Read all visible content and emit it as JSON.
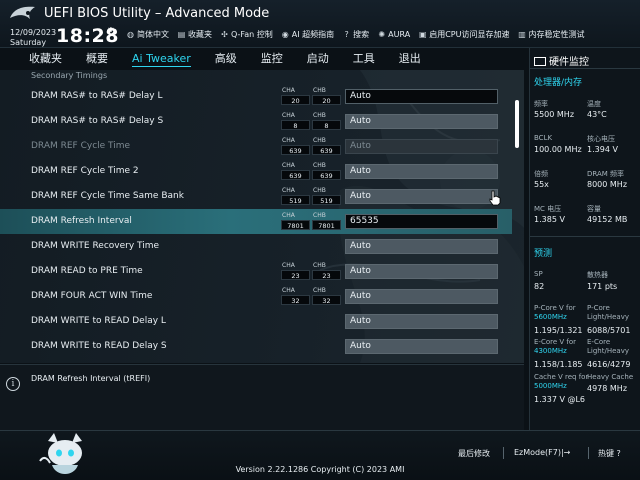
{
  "window": {
    "title": "UEFI BIOS Utility – Advanced Mode"
  },
  "header": {
    "date": "12/09/2023",
    "day": "Saturday",
    "time": "18:28",
    "toolbar": [
      {
        "icon": "globe-icon",
        "label": "简体中文"
      },
      {
        "icon": "favorites-icon",
        "label": "收藏夹"
      },
      {
        "icon": "fan-icon",
        "label": "Q-Fan 控制"
      },
      {
        "icon": "ai-overclock-icon",
        "label": "AI 超频指南"
      },
      {
        "icon": "search-icon",
        "label": "搜索"
      },
      {
        "icon": "aura-icon",
        "label": "AURA"
      },
      {
        "icon": "memory-cache-icon",
        "label": "启用CPU访问显存加速"
      },
      {
        "icon": "memory-stability-icon",
        "label": "内存稳定性测试"
      }
    ]
  },
  "menu": [
    {
      "label": "收藏夹",
      "active": false
    },
    {
      "label": "概要",
      "active": false
    },
    {
      "label": "Ai Tweaker",
      "active": true
    },
    {
      "label": "高级",
      "active": false
    },
    {
      "label": "监控",
      "active": false
    },
    {
      "label": "启动",
      "active": false
    },
    {
      "label": "工具",
      "active": false
    },
    {
      "label": "退出",
      "active": false
    }
  ],
  "main": {
    "section_title": "Secondary Timings",
    "channel_labels": {
      "a": "CHA",
      "b": "CHB"
    },
    "rows": [
      {
        "label": "DRAM RAS# to RAS# Delay L",
        "cha": "20",
        "chb": "20",
        "value": "Auto",
        "state": "selected-box"
      },
      {
        "label": "DRAM RAS# to RAS# Delay S",
        "cha": "8",
        "chb": "8",
        "value": "Auto",
        "state": "hover"
      },
      {
        "label": "DRAM REF Cycle Time",
        "cha": "639",
        "chb": "639",
        "value": "Auto",
        "state": "disabled"
      },
      {
        "label": "DRAM REF Cycle Time 2",
        "cha": "639",
        "chb": "639",
        "value": "Auto",
        "state": "normal"
      },
      {
        "label": "DRAM REF Cycle Time Same Bank",
        "cha": "519",
        "chb": "519",
        "value": "Auto",
        "state": "normal"
      },
      {
        "label": "DRAM Refresh Interval",
        "cha": "7801",
        "chb": "7801",
        "value": "65535",
        "state": "highlighted"
      },
      {
        "label": "DRAM WRITE Recovery Time",
        "cha": "",
        "chb": "",
        "value": "Auto",
        "state": "normal"
      },
      {
        "label": "DRAM READ to PRE Time",
        "cha": "23",
        "chb": "23",
        "value": "Auto",
        "state": "normal"
      },
      {
        "label": "DRAM FOUR ACT WIN Time",
        "cha": "32",
        "chb": "32",
        "value": "Auto",
        "state": "normal"
      },
      {
        "label": "DRAM WRITE to READ Delay L",
        "cha": "",
        "chb": "",
        "value": "Auto",
        "state": "normal"
      },
      {
        "label": "DRAM WRITE to READ Delay S",
        "cha": "",
        "chb": "",
        "value": "Auto",
        "state": "normal"
      }
    ]
  },
  "help": {
    "text": "DRAM Refresh Interval (tREFI)"
  },
  "monitor": {
    "title": "硬件监控",
    "cpu_section": "处理器/内存",
    "cpu": [
      {
        "k1": "频率",
        "v1": "5500 MHz",
        "k2": "温度",
        "v2": "43°C"
      },
      {
        "k1": "BCLK",
        "v1": "100.00 MHz",
        "k2": "核心电压",
        "v2": "1.394 V"
      },
      {
        "k1": "倍频",
        "v1": "55x",
        "k2": "DRAM 频率",
        "v2": "8000 MHz"
      },
      {
        "k1": "MC 电压",
        "v1": "1.385 V",
        "k2": "容量",
        "v2": "49152 MB"
      }
    ],
    "predict_section": "预测",
    "sp_label": "SP",
    "sp_value": "82",
    "cool_label": "散热器",
    "cool_value": "171 pts",
    "pcore_label": "P-Core V for",
    "pcore_freq": "5600MHz",
    "pcore_value": "1.195/1.321",
    "pcore_lh_label": "P-Core Light/Heavy",
    "pcore_lh_value": "6088/5701",
    "ecore_label": "E-Core V for",
    "ecore_freq": "4300MHz",
    "ecore_value": "1.158/1.185",
    "ecore_lh_label": "E-Core Light/Heavy",
    "ecore_lh_value": "4616/4279",
    "cache_label": "Cache V req for",
    "cache_freq": "5000MHz",
    "cache_value": "1.337 V @L6",
    "heavy_cache_label": "Heavy Cache",
    "heavy_cache_value": "4978 MHz"
  },
  "footer": {
    "version": "Version 2.22.1286 Copyright (C) 2023 AMI",
    "last_modified": "最后修改",
    "ezmode": "EzMode(F7)|→",
    "hotkey": "热键 ?"
  },
  "colors": {
    "accent": "#2fd5ef",
    "highlight_row": "#2a6f7a",
    "background": "#0b1116"
  }
}
